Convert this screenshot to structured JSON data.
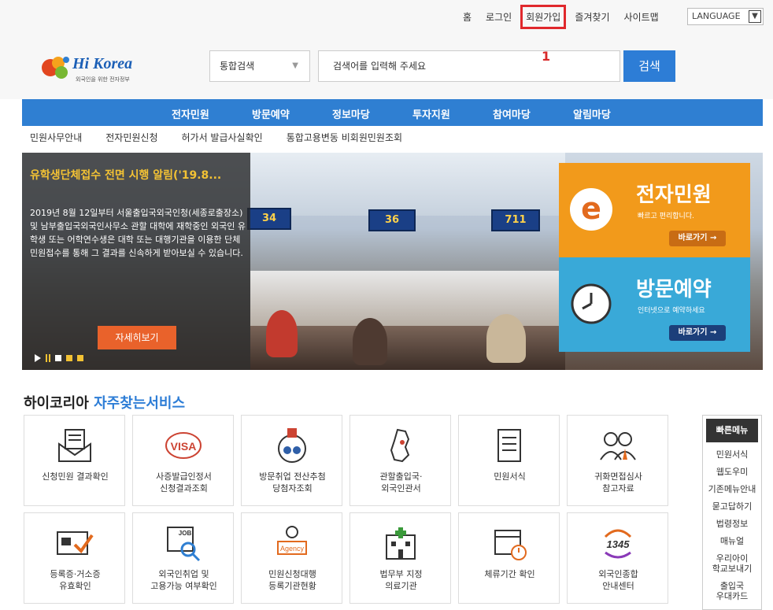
{
  "topbar": {
    "links": [
      "홈",
      "로그인",
      "회원가입",
      "즐겨찾기",
      "사이트맵"
    ],
    "language": "LANGUAGE"
  },
  "annotation": "1",
  "logo": {
    "brand": "Hi Korea",
    "tagline": "외국인을 위한 전자정부"
  },
  "search": {
    "category": "통합검색",
    "placeholder": "검색어를 입력해 주세요",
    "button": "검색"
  },
  "nav": [
    "전자민원",
    "방문예약",
    "정보마당",
    "투자지원",
    "참여마당",
    "알림마당"
  ],
  "subnav": [
    "민원사무안내",
    "전자민원신청",
    "허가서 발급사실확인",
    "통합고용변동 비회원민원조회"
  ],
  "hero": {
    "title": "유학생단체접수 전면 시행 알림('19.8...",
    "description": "2019년 8월 12일부터 서울출입국외국인청(세종로출장소) 및 남부출입국외국인사무소 관할 대학에 재학중인 외국인 유학생 또는 어학연수생은 대학 또는 대행기관을 이용한 단체 민원접수를 통해 그 결과를 신속하게 받아보실 수 있습니다.",
    "more": "자세히보기",
    "signs": [
      "34",
      "36",
      "711"
    ]
  },
  "tiles": {
    "e_civil": {
      "title": "전자민원",
      "sub": "빠르고 편리합니다.",
      "go": "바로가기 →"
    },
    "visit": {
      "title": "방문예약",
      "sub": "인터넷으로 예약하세요",
      "go": "바로가기 →"
    }
  },
  "services": {
    "heading_a": "하이코리아",
    "heading_b": "자주찾는서비스",
    "items": [
      {
        "label": "신청민원 결과확인",
        "icon": "envelope-document-icon"
      },
      {
        "label": "사증발급인정서\n신청결과조회",
        "icon": "visa-stamp-icon"
      },
      {
        "label": "방문취업 전산추첨\n당첨자조회",
        "icon": "lottery-icon"
      },
      {
        "label": "관할출입국·\n외국인관서",
        "icon": "korea-map-icon"
      },
      {
        "label": "민원서식",
        "icon": "form-document-icon"
      },
      {
        "label": "귀화면접심사\n참고자료",
        "icon": "people-icon"
      },
      {
        "label": "등록증·거소증\n유효확인",
        "icon": "id-card-check-icon"
      },
      {
        "label": "외국인취업 및\n고용가능 여부확인",
        "icon": "job-search-icon"
      },
      {
        "label": "민원신청대행\n등록기관현황",
        "icon": "agency-icon"
      },
      {
        "label": "법무부 지정\n의료기관",
        "icon": "hospital-icon"
      },
      {
        "label": "체류기간 확인",
        "icon": "calendar-clock-icon"
      },
      {
        "label": "외국인종합\n안내센터",
        "icon": "call-center-1345-icon"
      }
    ]
  },
  "quick_menu": {
    "title": "빠른메뉴",
    "items": [
      "민원서식",
      "웹도우미",
      "기존메뉴안내",
      "묻고답하기",
      "법령정보",
      "매뉴얼",
      "우리아이\n학교보내기",
      "출입국\n우대카드"
    ]
  },
  "colors": {
    "primary": "#2f7fd2",
    "accent": "#f3c234",
    "highlight": "#e0282c"
  }
}
